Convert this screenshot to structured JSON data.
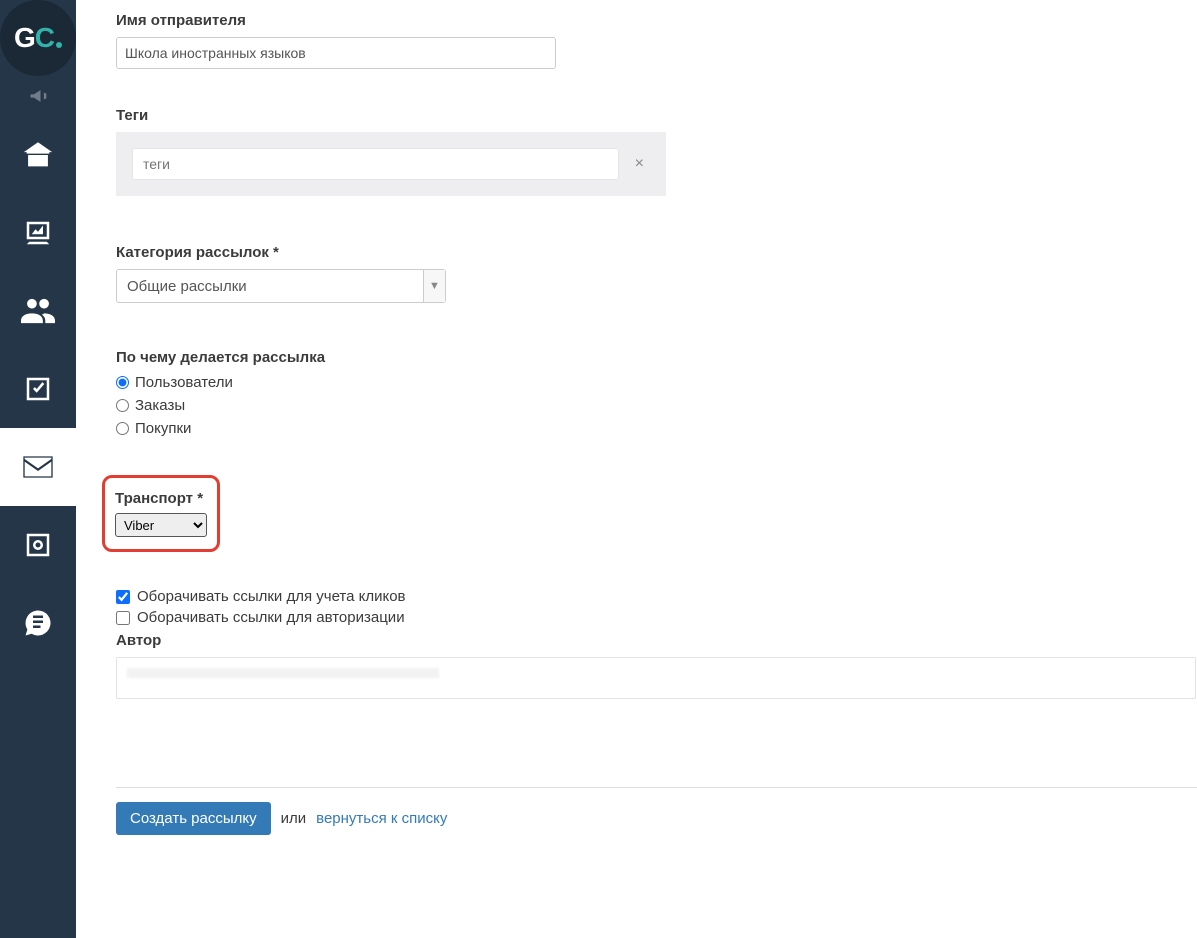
{
  "sender": {
    "label": "Имя отправителя",
    "value": "Школа иностранных языков"
  },
  "tags": {
    "label": "Теги",
    "placeholder": "теги"
  },
  "category": {
    "label": "Категория рассылок *",
    "selected": "Общие рассылки"
  },
  "basis": {
    "label": "По чему делается рассылка",
    "options": [
      "Пользователи",
      "Заказы",
      "Покупки"
    ],
    "selected_index": 0
  },
  "transport": {
    "label": "Транспорт *",
    "selected": "Viber"
  },
  "checkboxes": {
    "wrap_clicks": {
      "label": "Оборачивать ссылки для учета кликов",
      "checked": true
    },
    "wrap_auth": {
      "label": "Оборачивать ссылки для авторизации",
      "checked": false
    }
  },
  "author": {
    "label": "Автор"
  },
  "footer": {
    "submit": "Создать рассылку",
    "or": "или",
    "back_link": "вернуться к списку"
  }
}
